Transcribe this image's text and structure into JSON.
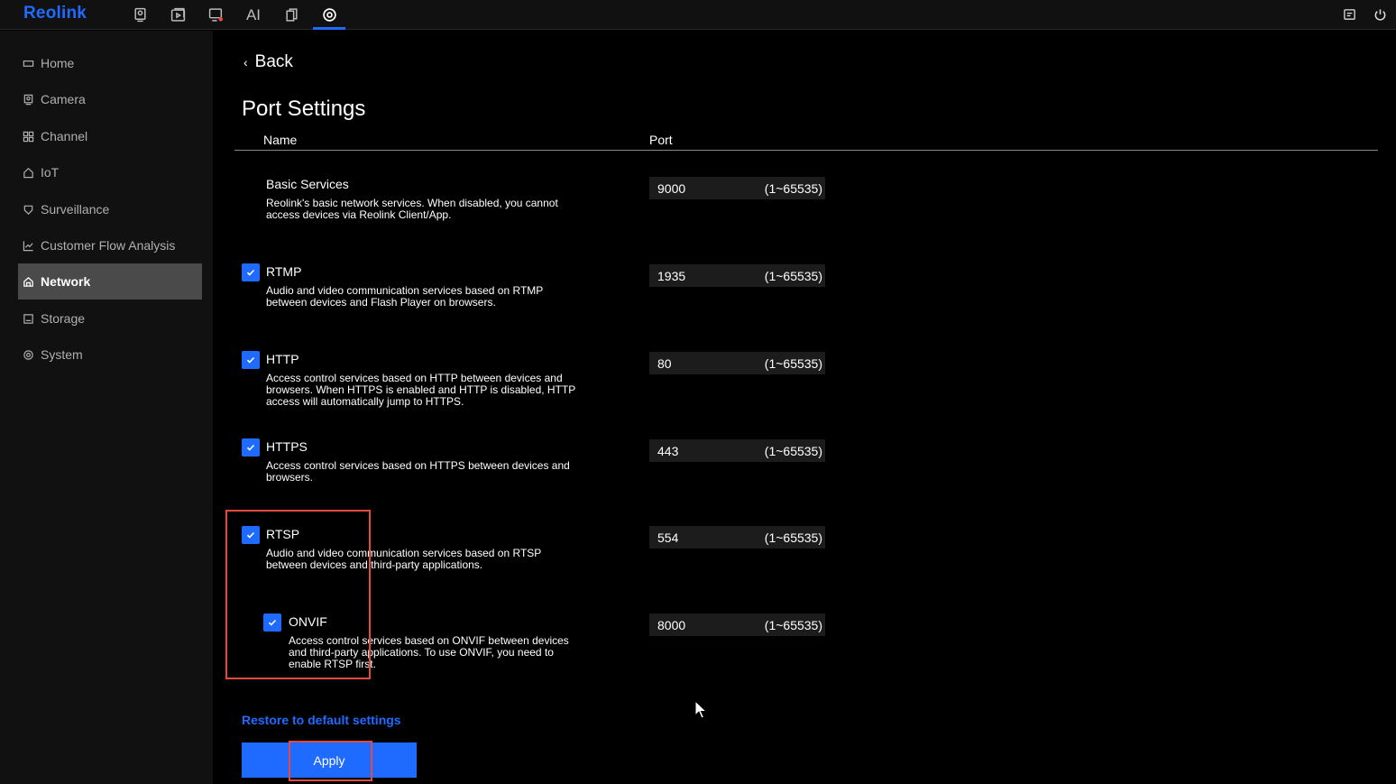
{
  "app": {
    "logo": "Reolink"
  },
  "topnav": {
    "items": [
      {
        "name": "camera-preview-icon"
      },
      {
        "name": "playback-icon"
      },
      {
        "name": "alarm-icon"
      },
      {
        "name": "ai-label",
        "label": "AI"
      },
      {
        "name": "files-icon"
      },
      {
        "name": "settings-icon",
        "active": true
      }
    ],
    "right": [
      "message-icon",
      "power-icon"
    ]
  },
  "sidebar": {
    "items": [
      {
        "label": "Home",
        "icon": "home-icon"
      },
      {
        "label": "Camera",
        "icon": "camera-icon"
      },
      {
        "label": "Channel",
        "icon": "channel-grid-icon"
      },
      {
        "label": "IoT",
        "icon": "iot-house-icon"
      },
      {
        "label": "Surveillance",
        "icon": "shield-icon"
      },
      {
        "label": "Customer Flow Analysis",
        "icon": "line-chart-icon"
      },
      {
        "label": "Network",
        "icon": "network-icon",
        "active": true
      },
      {
        "label": "Storage",
        "icon": "storage-icon"
      },
      {
        "label": "System",
        "icon": "system-gear-icon"
      }
    ]
  },
  "main": {
    "back_label": "Back",
    "title": "Port Settings",
    "columns": {
      "name": "Name",
      "port": "Port"
    },
    "services": [
      {
        "name": "Basic Services",
        "checkbox": false,
        "checked": false,
        "desc": "Reolink's basic network services. When disabled, you cannot access devices via Reolink Client/App.",
        "port": "9000",
        "range": "(1~65535)"
      },
      {
        "name": "RTMP",
        "checkbox": true,
        "checked": true,
        "desc": "Audio and video communication services based on RTMP between devices and Flash Player on browsers.",
        "port": "1935",
        "range": "(1~65535)"
      },
      {
        "name": "HTTP",
        "checkbox": true,
        "checked": true,
        "desc": "Access control services based on HTTP between devices and browsers. When HTTPS is enabled and HTTP is disabled, HTTP access will automatically jump to HTTPS.",
        "port": "80",
        "range": "(1~65535)"
      },
      {
        "name": "HTTPS",
        "checkbox": true,
        "checked": true,
        "desc": "Access control services based on HTTPS between devices and browsers.",
        "port": "443",
        "range": "(1~65535)"
      },
      {
        "name": "RTSP",
        "checkbox": true,
        "checked": true,
        "desc": "Audio and video communication services based on RTSP between devices and third-party applications.",
        "port": "554",
        "range": "(1~65535)"
      },
      {
        "name": "ONVIF",
        "checkbox": true,
        "checked": true,
        "desc": "Access control services based on ONVIF between devices and third-party applications. To use ONVIF, you need to enable RTSP first.",
        "port": "8000",
        "range": "(1~65535)"
      }
    ],
    "restore_label": "Restore to default settings",
    "apply_label": "Apply"
  },
  "colors": {
    "accent": "#1f6bff",
    "highlight": "#e5493f",
    "active_side": "#4a4a4a"
  }
}
